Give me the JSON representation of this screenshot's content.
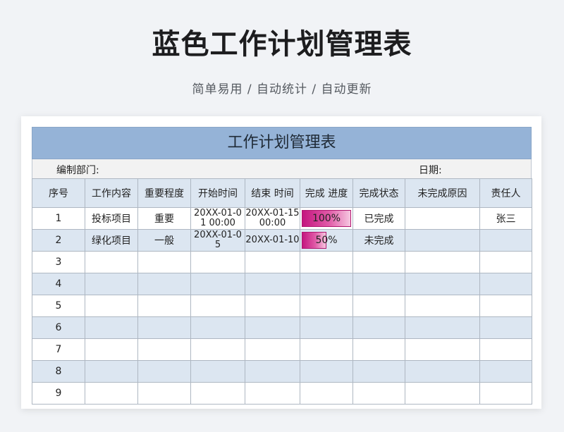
{
  "hero": {
    "title": "蓝色工作计划管理表",
    "subtitle": "简单易用 / 自动统计 / 自动更新"
  },
  "sheet": {
    "title": "工作计划管理表",
    "dept_label": "编制部门:",
    "date_label": "日期:",
    "columns": [
      "序号",
      "工作内容",
      "重要程度",
      "开始时间",
      "结束 时间",
      "完成 进度",
      "完成状态",
      "未完成原因",
      "责任人"
    ],
    "rows": [
      {
        "no": "1",
        "content": "投标项目",
        "importance": "重要",
        "start": "20XX-01-01 00:00",
        "end": "20XX-01-15 00:00",
        "progress_label": "100%",
        "progress": 1.0,
        "status": "已完成",
        "reason": "",
        "owner": "张三"
      },
      {
        "no": "2",
        "content": "绿化项目",
        "importance": "一般",
        "start": "20XX-01-05",
        "end": "20XX-01-10",
        "progress_label": "50%",
        "progress": 0.5,
        "status": "未完成",
        "reason": "",
        "owner": ""
      },
      {
        "no": "3",
        "content": "",
        "importance": "",
        "start": "",
        "end": "",
        "progress_label": "",
        "progress": null,
        "status": "",
        "reason": "",
        "owner": ""
      },
      {
        "no": "4",
        "content": "",
        "importance": "",
        "start": "",
        "end": "",
        "progress_label": "",
        "progress": null,
        "status": "",
        "reason": "",
        "owner": ""
      },
      {
        "no": "5",
        "content": "",
        "importance": "",
        "start": "",
        "end": "",
        "progress_label": "",
        "progress": null,
        "status": "",
        "reason": "",
        "owner": ""
      },
      {
        "no": "6",
        "content": "",
        "importance": "",
        "start": "",
        "end": "",
        "progress_label": "",
        "progress": null,
        "status": "",
        "reason": "",
        "owner": ""
      },
      {
        "no": "7",
        "content": "",
        "importance": "",
        "start": "",
        "end": "",
        "progress_label": "",
        "progress": null,
        "status": "",
        "reason": "",
        "owner": ""
      },
      {
        "no": "8",
        "content": "",
        "importance": "",
        "start": "",
        "end": "",
        "progress_label": "",
        "progress": null,
        "status": "",
        "reason": "",
        "owner": ""
      },
      {
        "no": "9",
        "content": "",
        "importance": "",
        "start": "",
        "end": "",
        "progress_label": "",
        "progress": null,
        "status": "",
        "reason": "",
        "owner": ""
      }
    ]
  },
  "colors": {
    "banner": "#95b3d7",
    "header_row": "#dce6f1",
    "progress_bar": "#c4167f"
  }
}
